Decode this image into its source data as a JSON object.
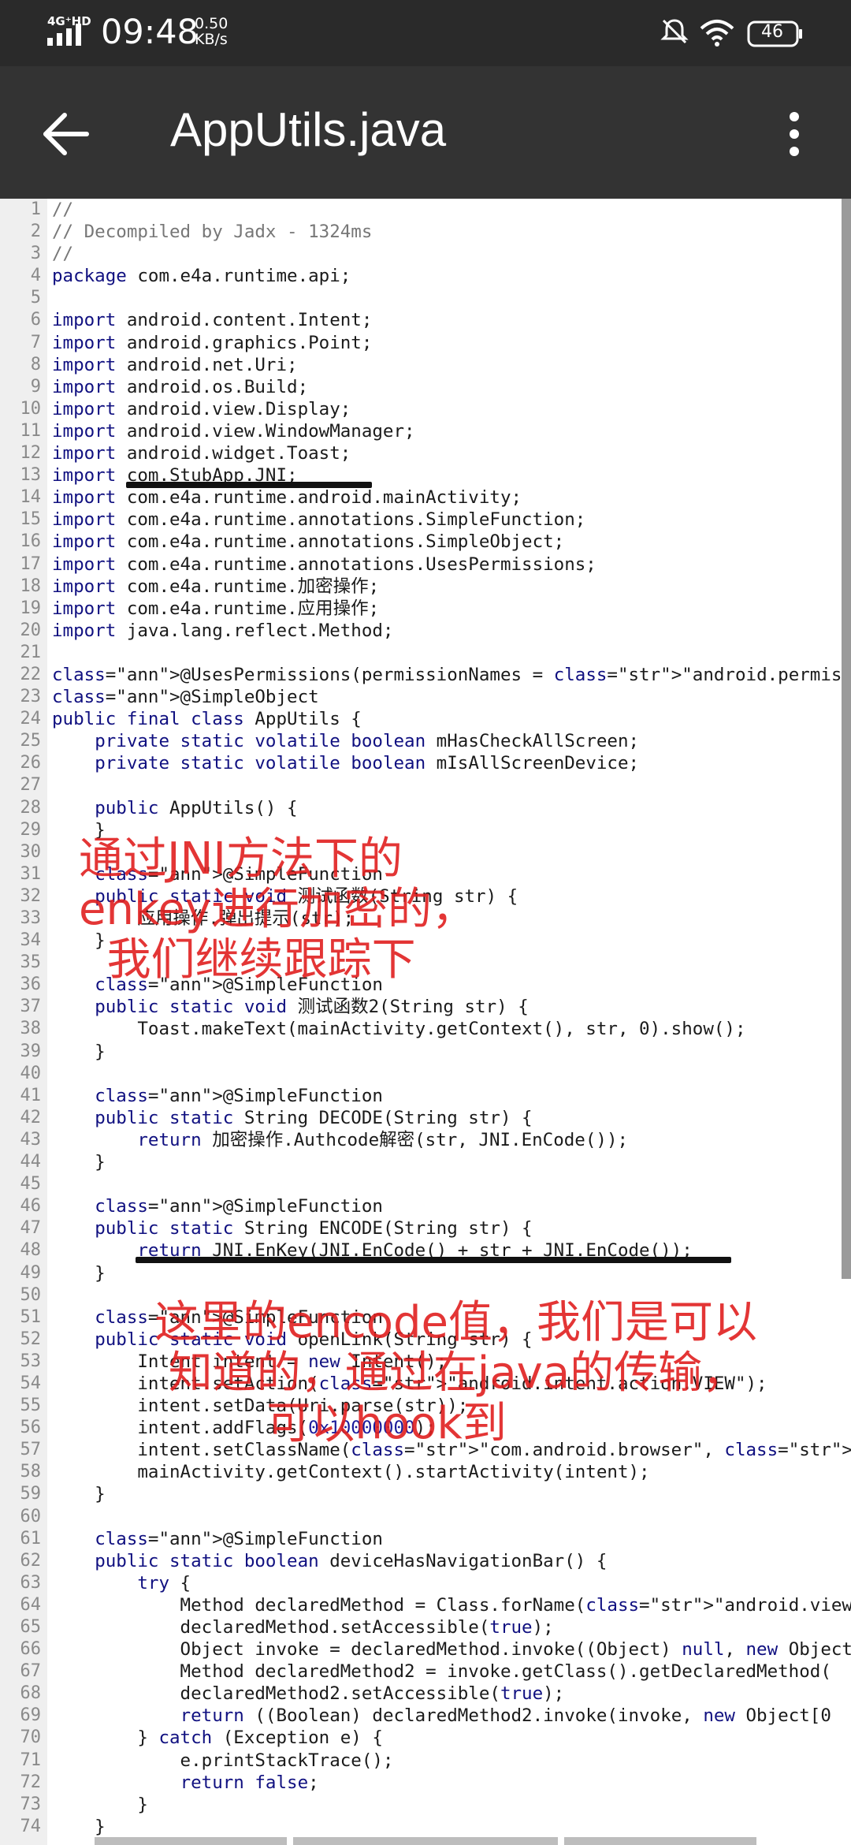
{
  "status_bar": {
    "network": "4G⁺HD",
    "time": "09:48",
    "speed_value": "0.50",
    "speed_unit": "KB/s",
    "battery": "46",
    "icons": [
      "signal-icon",
      "mute-icon",
      "wifi-icon",
      "battery-icon"
    ]
  },
  "app_bar": {
    "title": "AppUtils.java",
    "icons": [
      "back-arrow-icon",
      "more-vert-icon"
    ]
  },
  "code": {
    "lines": [
      "//",
      "// Decompiled by Jadx - 1324ms",
      "//",
      "package com.e4a.runtime.api;",
      "",
      "import android.content.Intent;",
      "import android.graphics.Point;",
      "import android.net.Uri;",
      "import android.os.Build;",
      "import android.view.Display;",
      "import android.view.WindowManager;",
      "import android.widget.Toast;",
      "import com.StubApp.JNI;",
      "import com.e4a.runtime.android.mainActivity;",
      "import com.e4a.runtime.annotations.SimpleFunction;",
      "import com.e4a.runtime.annotations.SimpleObject;",
      "import com.e4a.runtime.annotations.UsesPermissions;",
      "import com.e4a.runtime.加密操作;",
      "import com.e4a.runtime.应用操作;",
      "import java.lang.reflect.Method;",
      "",
      "@UsesPermissions(permissionNames = \"android.permission.INTERNET\")",
      "@SimpleObject",
      "public final class AppUtils {",
      "    private static volatile boolean mHasCheckAllScreen;",
      "    private static volatile boolean mIsAllScreenDevice;",
      "",
      "    public AppUtils() {",
      "    }",
      "",
      "    @SimpleFunction",
      "    public static void 测试函数(String str) {",
      "        应用操作.弹出提示(str);",
      "    }",
      "",
      "    @SimpleFunction",
      "    public static void 测试函数2(String str) {",
      "        Toast.makeText(mainActivity.getContext(), str, 0).show();",
      "    }",
      "",
      "    @SimpleFunction",
      "    public static String DECODE(String str) {",
      "        return 加密操作.Authcode解密(str, JNI.EnCode());",
      "    }",
      "",
      "    @SimpleFunction",
      "    public static String ENCODE(String str) {",
      "        return JNI.EnKey(JNI.EnCode() + str + JNI.EnCode());",
      "    }",
      "",
      "    @SimpleFunction",
      "    public static void openLink(String str) {",
      "        Intent intent = new Intent();",
      "        intent.setAction(\"android.intent.action.VIEW\");",
      "        intent.setData(Uri.parse(str));",
      "        intent.addFlags(0x10000000);",
      "        intent.setClassName(\"com.android.browser\", \"com.android.browser.BrowserActivity\");",
      "        mainActivity.getContext().startActivity(intent);",
      "    }",
      "",
      "    @SimpleFunction",
      "    public static boolean deviceHasNavigationBar() {",
      "        try {",
      "            Method declaredMethod = Class.forName(\"android.view.WindowManagerGlobal\")",
      "            declaredMethod.setAccessible(true);",
      "            Object invoke = declaredMethod.invoke((Object) null, new Object",
      "            Method declaredMethod2 = invoke.getClass().getDeclaredMethod(",
      "            declaredMethod2.setAccessible(true);",
      "            return ((Boolean) declaredMethod2.invoke(invoke, new Object[0",
      "        } catch (Exception e) {",
      "            e.printStackTrace();",
      "            return false;",
      "        }",
      "    }"
    ]
  },
  "annotations": {
    "note1": "通过JNI方法下的\nenkey进行加密的，\n  我们继续跟踪下",
    "note2": "这里的encode值，我们是可以\n 知道的，通过在java的传输，\n        可以hook到",
    "color": "#e02020"
  },
  "colors": {
    "status_bar": "#2a2a2a",
    "app_bar": "#333333",
    "keyword": "#101080",
    "string": "#1a7a1a",
    "annotation": "#9a8a00",
    "line_number": "#8a8a8a"
  }
}
